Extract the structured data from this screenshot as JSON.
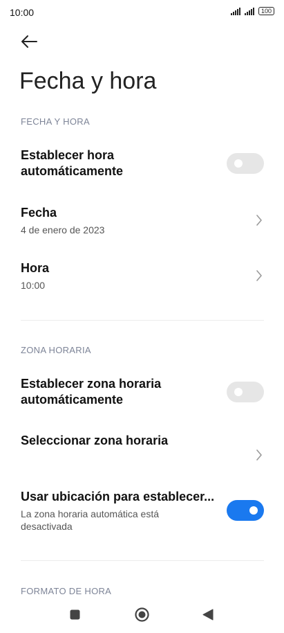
{
  "status_bar": {
    "time": "10:00",
    "battery": "100"
  },
  "header": {
    "title": "Fecha y hora"
  },
  "sections": {
    "date_time": {
      "header": "FECHA Y HORA",
      "auto_time": {
        "title_line1": "Establecer hora",
        "title_line2": "automáticamente",
        "enabled": false
      },
      "date": {
        "title": "Fecha",
        "value": "4 de enero de 2023"
      },
      "time": {
        "title": "Hora",
        "value": "10:00"
      }
    },
    "time_zone": {
      "header": "ZONA HORARIA",
      "auto_zone": {
        "title_line1": "Establecer zona horaria",
        "title_line2": "automáticamente",
        "enabled": false
      },
      "select_zone": {
        "title": "Seleccionar zona horaria"
      },
      "use_location": {
        "title": "Usar ubicación para establecer...",
        "subtitle_line1": "La zona horaria automática está",
        "subtitle_line2": "desactivada",
        "enabled": true
      }
    },
    "time_format": {
      "header": "FORMATO DE HORA"
    }
  },
  "colors": {
    "accent": "#1a79ef",
    "toggle_off": "#e6e6e6",
    "section_header": "#7d8497"
  },
  "icons": {
    "back": "arrow-left-icon",
    "chevron": "chevron-right-icon",
    "nav_recents": "square-icon",
    "nav_home": "circle-icon",
    "nav_back": "triangle-left-icon"
  }
}
